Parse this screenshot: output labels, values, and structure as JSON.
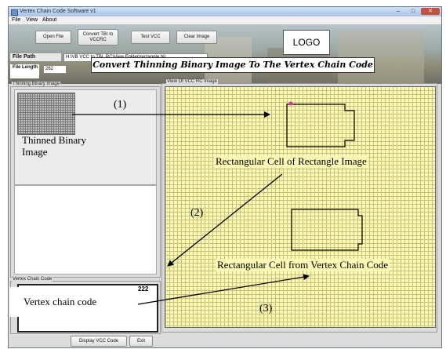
{
  "window": {
    "title": "Vertex Chain Code Software v1",
    "controls": {
      "minimize": "–",
      "maximize": "□",
      "close": "✕"
    }
  },
  "menu": {
    "items": [
      "File",
      "View",
      "About"
    ]
  },
  "toolbar": {
    "open_file": "Open File",
    "convert": "Convert TBI to VCCRC",
    "test_vcc": "Test VCC",
    "clear_image": "Clear Image"
  },
  "logo": {
    "text": "LOGO"
  },
  "file_path": {
    "label": "File Path",
    "value": "H:\\VB VCC to TBI_RC\\View Folder\\rectangle.bit"
  },
  "file_length": {
    "label": "File Length",
    "value": "262"
  },
  "headline": "Convert Thinning Binary Image To The Vertex Chain Code",
  "left_panel": {
    "title": "Thinning Binary Image",
    "caption_line1": "Thinned Binary",
    "caption_line2": "Image"
  },
  "right_panel": {
    "title": "View Of VCC RC Image"
  },
  "vcc_panel": {
    "title": "Vertex Chain Code",
    "code_value": "222",
    "caption": "Vertex chain code"
  },
  "annotations": {
    "step1": "(1)",
    "step2": "(2)",
    "step3": "(3)",
    "rect_cell_image": "Rectangular Cell of Rectangle Image",
    "rect_cell_vcc": "Rectangular Cell from Vertex Chain Code"
  },
  "bottom": {
    "display_vcc": "Display VCC Code",
    "exit": "Exit"
  },
  "colors": {
    "grid_bg": "#fbf8b5",
    "grid_line": "#c7c27a",
    "start_marker": "#d03aa0"
  }
}
